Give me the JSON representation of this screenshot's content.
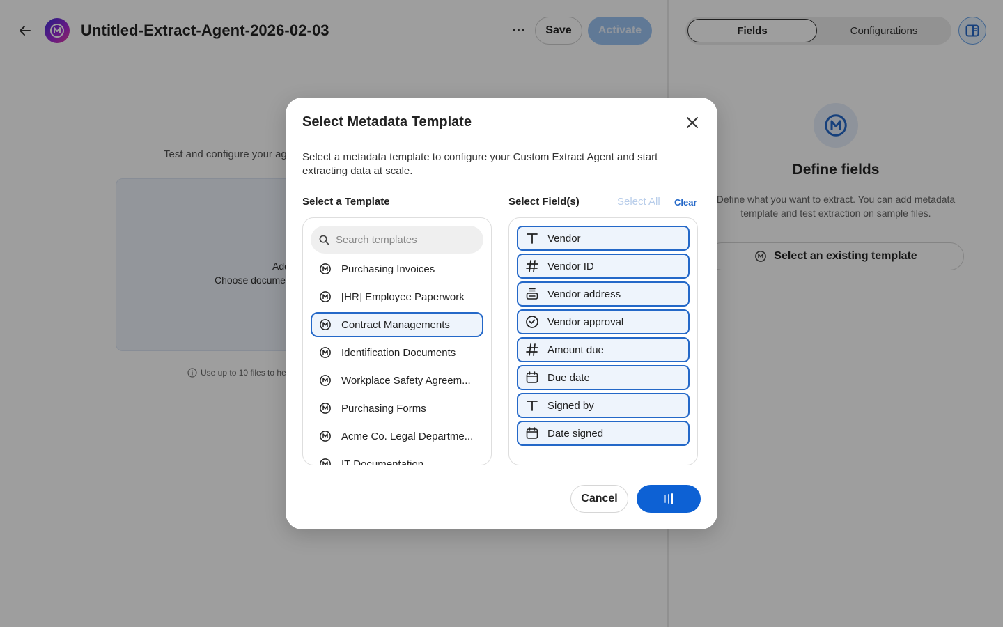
{
  "header": {
    "title": "Untitled-Extract-Agent-2026-02-03",
    "more_label": "···",
    "save_label": "Save",
    "activate_label": "Activate"
  },
  "left": {
    "test_text": "Test and configure your ag",
    "dropzone_add": "Add",
    "dropzone_choose": "Choose documen",
    "hint": "Use up to 10 files to he"
  },
  "right": {
    "tabs": [
      {
        "label": "Fields",
        "active": true
      },
      {
        "label": "Configurations",
        "active": false
      }
    ],
    "define_title": "Define fields",
    "define_desc": "Define what you want to extract. You can add metadata template and test extraction on sample files.",
    "existing_label": "Select an existing template"
  },
  "modal": {
    "title": "Select Metadata Template",
    "description": "Select a metadata template to configure your Custom Extract Agent and start extracting data at scale.",
    "template_label": "Select a Template",
    "fields_label": "Select Field(s)",
    "select_all": "Select All",
    "clear": "Clear",
    "search_placeholder": "Search templates",
    "templates": [
      {
        "name": "Purchasing Invoices",
        "selected": false
      },
      {
        "name": "[HR] Employee Paperwork",
        "selected": false
      },
      {
        "name": "Contract Managements",
        "selected": true
      },
      {
        "name": "Identification Documents",
        "selected": false
      },
      {
        "name": "Workplace Safety Agreem...",
        "selected": false
      },
      {
        "name": "Purchasing Forms",
        "selected": false
      },
      {
        "name": "Acme Co. Legal Departme...",
        "selected": false
      },
      {
        "name": "IT Documentation",
        "selected": false
      }
    ],
    "fields": [
      {
        "name": "Vendor",
        "icon": "text-type-icon"
      },
      {
        "name": "Vendor ID",
        "icon": "number-type-icon"
      },
      {
        "name": "Vendor address",
        "icon": "multiline-type-icon"
      },
      {
        "name": "Vendor approval",
        "icon": "checkmark-circle-icon"
      },
      {
        "name": "Amount due",
        "icon": "number-type-icon"
      },
      {
        "name": "Due date",
        "icon": "calendar-icon"
      },
      {
        "name": "Signed by",
        "icon": "text-type-icon"
      },
      {
        "name": "Date signed",
        "icon": "calendar-icon"
      }
    ],
    "cancel_label": "Cancel"
  },
  "colors": {
    "accent": "#0d61d4",
    "selection_border": "#2468c8",
    "selection_bg": "#eef4fc",
    "activate_disabled": "#9cc3f2"
  }
}
